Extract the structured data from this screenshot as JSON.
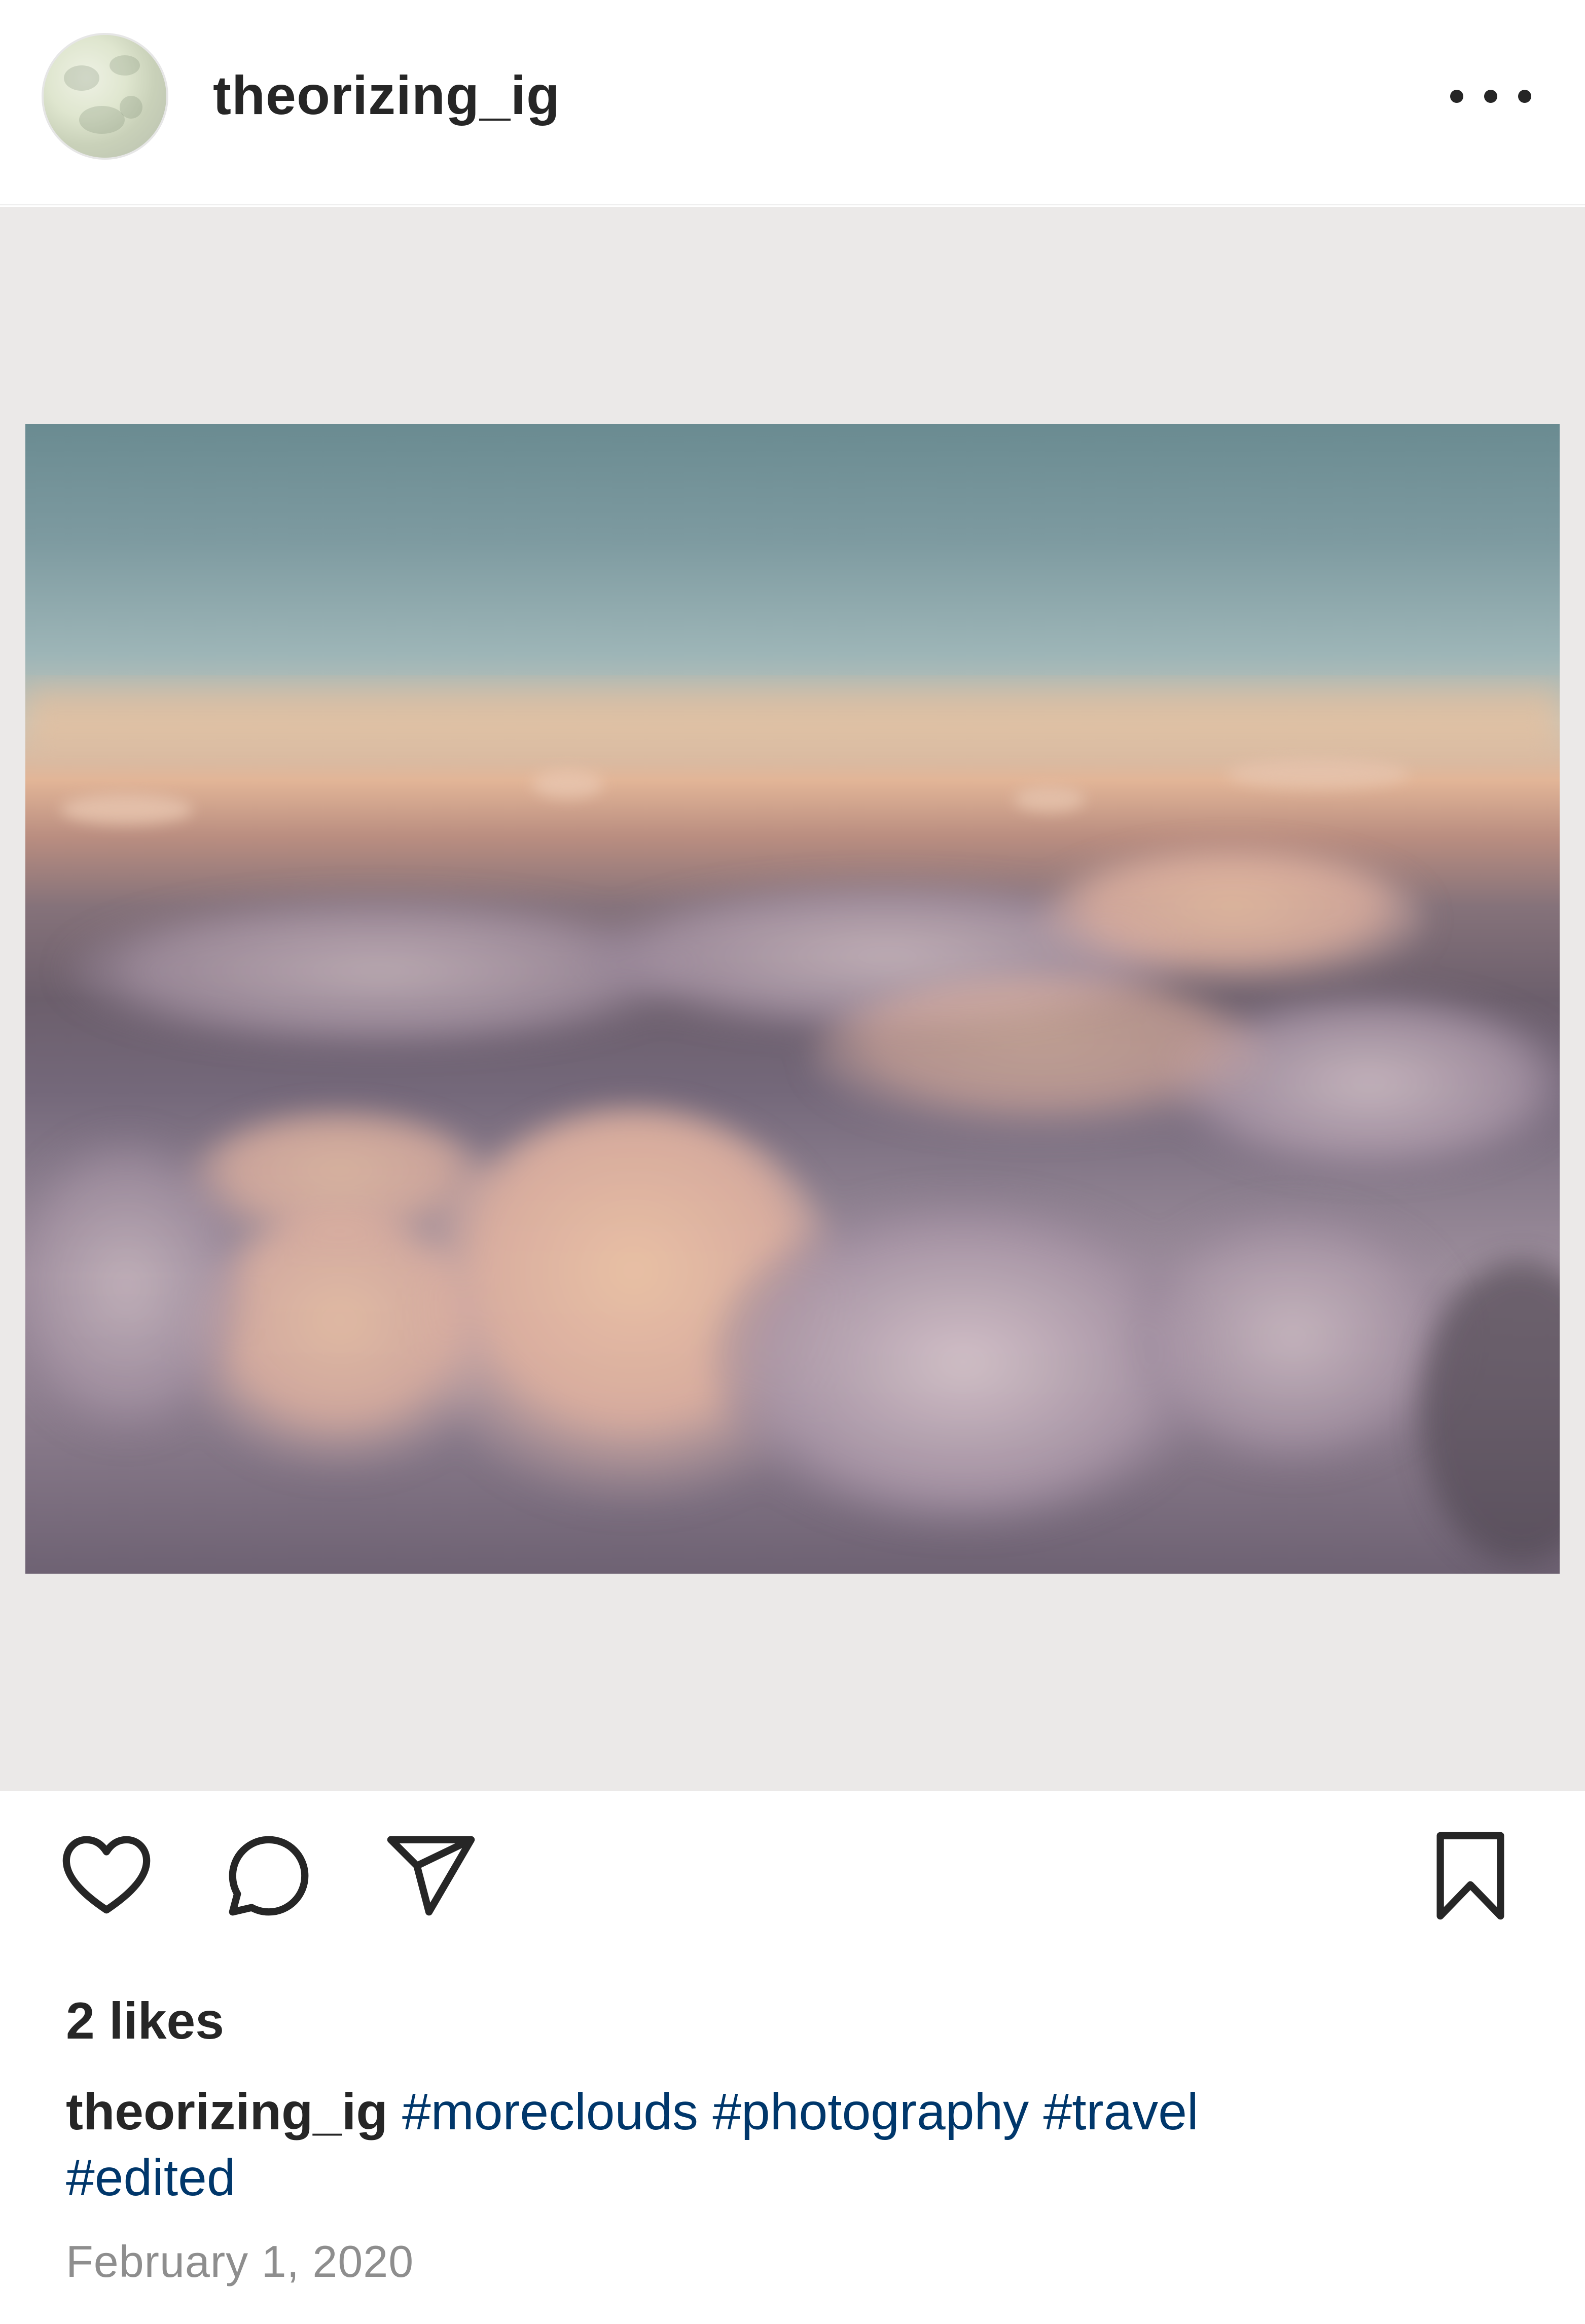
{
  "post": {
    "username": "theorizing_ig",
    "avatar": "avatar",
    "more_icon": "more-icon",
    "image_alt": "clouds-photo",
    "actions": {
      "like_icon": "heart-icon",
      "comment_icon": "comment-icon",
      "share_icon": "send-icon",
      "save_icon": "bookmark-icon"
    },
    "likes": "2 likes",
    "caption": {
      "username": "theorizing_ig",
      "hashtags": [
        "#moreclouds",
        "#photography",
        "#travel",
        "#edited"
      ]
    },
    "date": "February 1, 2020"
  },
  "colors": {
    "text": "#262626",
    "hashtag": "#00376b",
    "secondary_text": "#8e8e8e",
    "media_background": "#ebe9e8"
  }
}
